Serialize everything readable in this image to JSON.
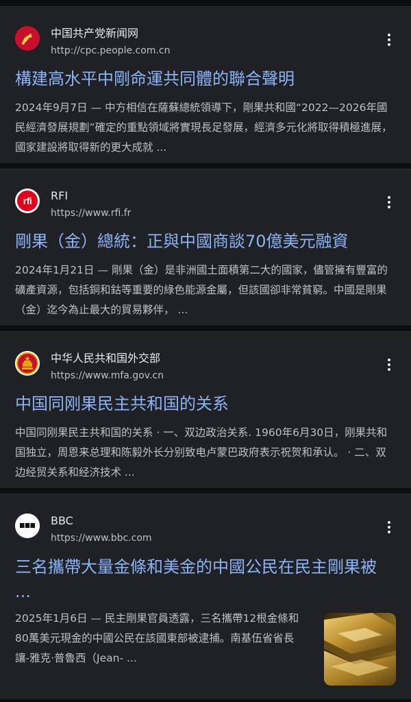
{
  "results": [
    {
      "source": "中国共产党新闻网",
      "url": "http://cpc.people.com.cn",
      "favicon": "cpc-emblem-icon",
      "title": "構建高水平中剛命運共同體的聯合聲明",
      "snippet": "2024年9月7日 — 中方相信在薩蘇總統領導下，剛果共和國“2022—2026年國民經濟發展規劃”確定的重點領域將實現長足發展，經濟多元化將取得積極進展，國家建設將取得新的更大成就 ..."
    },
    {
      "source": "RFI",
      "url": "https://www.rfi.fr",
      "favicon": "rfi-logo-icon",
      "favicon_text": "rfi",
      "title": "剛果（金）總統：正與中國商談70億美元融資",
      "snippet": "2024年1月21日 — 剛果（金）是非洲國土面積第二大的國家，儘管擁有豐富的礦產資源，包括銅和鈷等重要的綠色能源金屬，但該國卻非常貧窮。中國是剛果（金）迄今為止最大的貿易夥伴， ..."
    },
    {
      "source": "中华人民共和国外交部",
      "url": "https://www.mfa.gov.cn",
      "favicon": "national-emblem-icon",
      "title": "中国同刚果民主共和国的关系",
      "snippet": "中国同刚果民主共和国的关系 · 一、双边政治关系. 1960年6月30日，刚果共和国独立，周恩来总理和陈毅外长分别致电卢蒙巴政府表示祝贺和承认。 · 二、双边经贸关系和经济技术 ..."
    },
    {
      "source": "BBC",
      "url": "https://www.bbc.com",
      "favicon": "bbc-logo-icon",
      "title": "三名攜帶大量金條和美金的中國公民在民主剛果被 ...",
      "snippet": "2025年1月6日 — 民主剛果官員透露，三名攜帶12根金條和80萬美元現金的中國公民在該國東部被逮捕。南基伍省省長讓-雅克·普魯西（Jean- ...",
      "thumbnail": "gold-bars-image"
    }
  ],
  "colors": {
    "background": "#0d0e10",
    "card": "#202124",
    "title_link": "#8ab4f8",
    "snippet_text": "#bdc1c6",
    "source_text": "#e8eaed"
  }
}
